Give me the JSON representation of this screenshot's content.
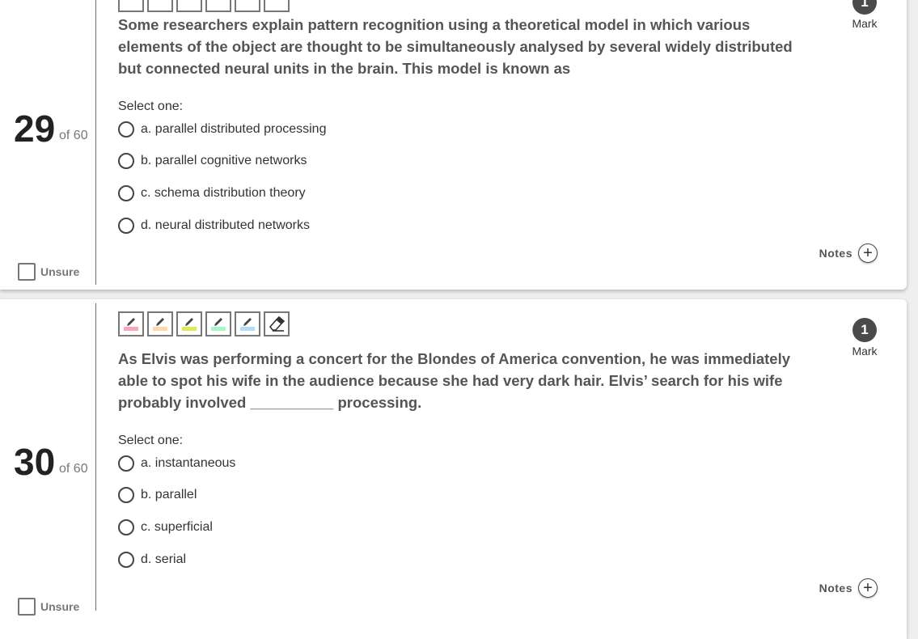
{
  "questions": [
    {
      "number": "29",
      "of_label": "of 60",
      "unsure_label": "Unsure",
      "mark_value": "1",
      "mark_label": "Mark",
      "text": "Some researchers explain pattern recognition using a theoretical model in which various elements of the object are thought to be simultaneously analysed by several widely distributed but connected neural units in the brain. This model is known as",
      "select_label": "Select one:",
      "options": [
        "a. parallel distributed processing",
        "b. parallel cognitive networks",
        "c. schema distribution theory",
        "d. neural distributed networks"
      ],
      "notes_label": "Notes"
    },
    {
      "number": "30",
      "of_label": "of 60",
      "unsure_label": "Unsure",
      "mark_value": "1",
      "mark_label": "Mark",
      "text": "As Elvis was performing a concert for the Blondes of America convention, he was immediately able to spot his wife in the audience because she had very dark hair. Elvis’ search for his wife probably involved __________ processing.",
      "select_label": "Select one:",
      "options": [
        "a. instantaneous",
        "b. parallel",
        "c. superficial",
        "d. serial"
      ],
      "notes_label": "Notes"
    }
  ],
  "highlighter_tools": [
    {
      "name": "highlighter-pink",
      "color": "#f7a8b8"
    },
    {
      "name": "highlighter-orange",
      "color": "#fcd9a8"
    },
    {
      "name": "highlighter-yellow",
      "color": "#dfe85a"
    },
    {
      "name": "highlighter-green",
      "color": "#a8f5c8"
    },
    {
      "name": "highlighter-blue",
      "color": "#b5dcf7"
    },
    {
      "name": "eraser",
      "color": ""
    }
  ]
}
